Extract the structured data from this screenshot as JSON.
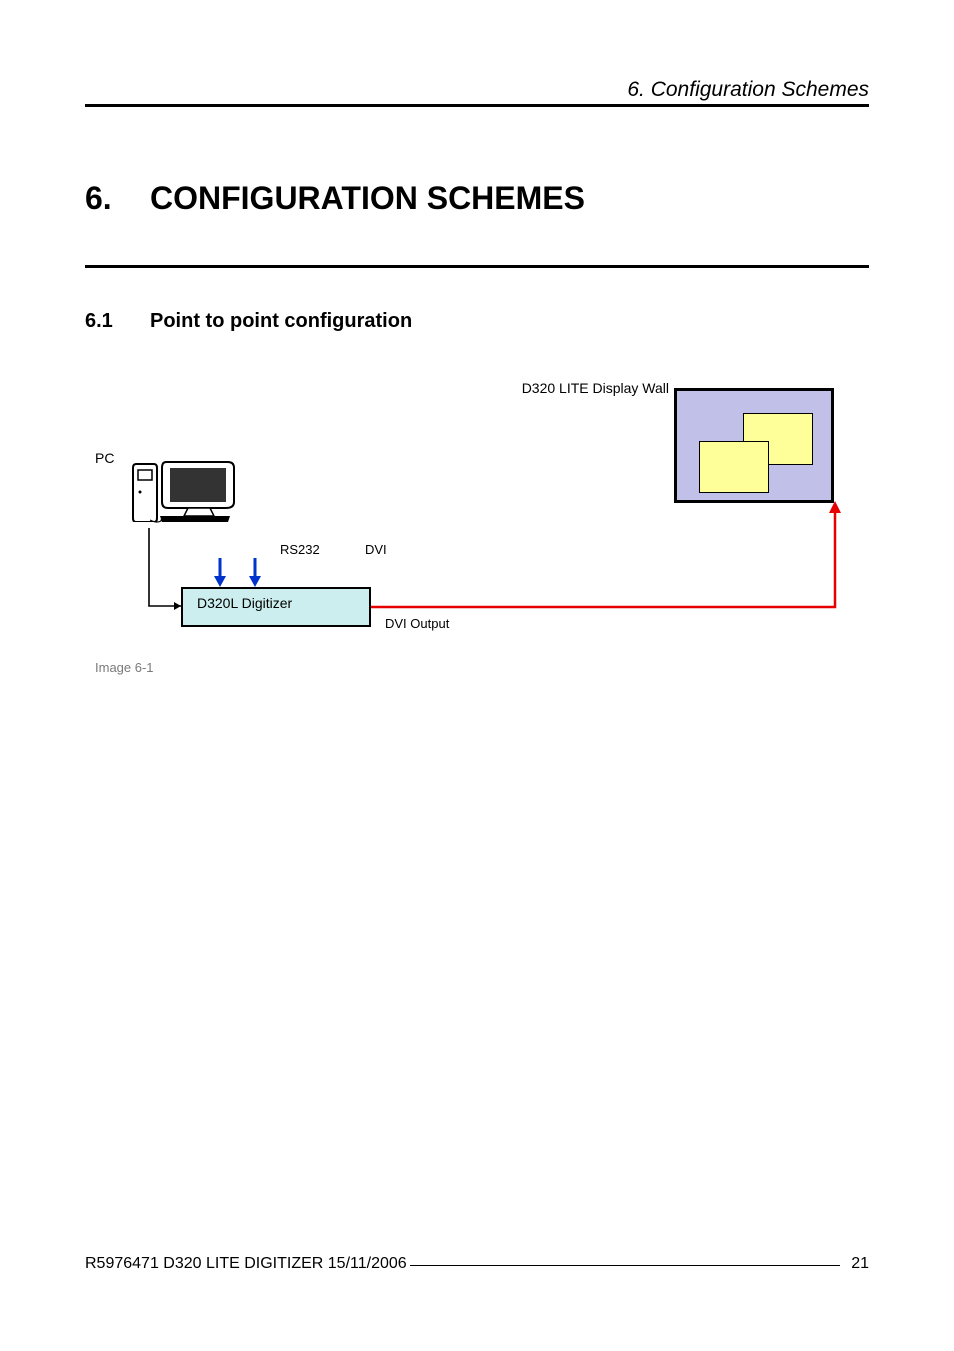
{
  "header": {
    "chapter_ref": "6.  Configuration Schemes"
  },
  "chapter": {
    "num": "6.",
    "title": "CONFIGURATION SCHEMES"
  },
  "section": {
    "num": "6.1",
    "title": "Point to point configuration"
  },
  "diagram": {
    "wall_label": "D320 LITE Display Wall",
    "pc_label": "PC",
    "digi_label": "D320L Digitizer",
    "rs232": "RS232",
    "dvi": "DVI",
    "dvi_out": "DVI Output",
    "caption": "Image 6-1"
  },
  "footer": {
    "doc": "R5976471  D320 LITE DIGITIZER  15/11/2006",
    "page": "21"
  }
}
